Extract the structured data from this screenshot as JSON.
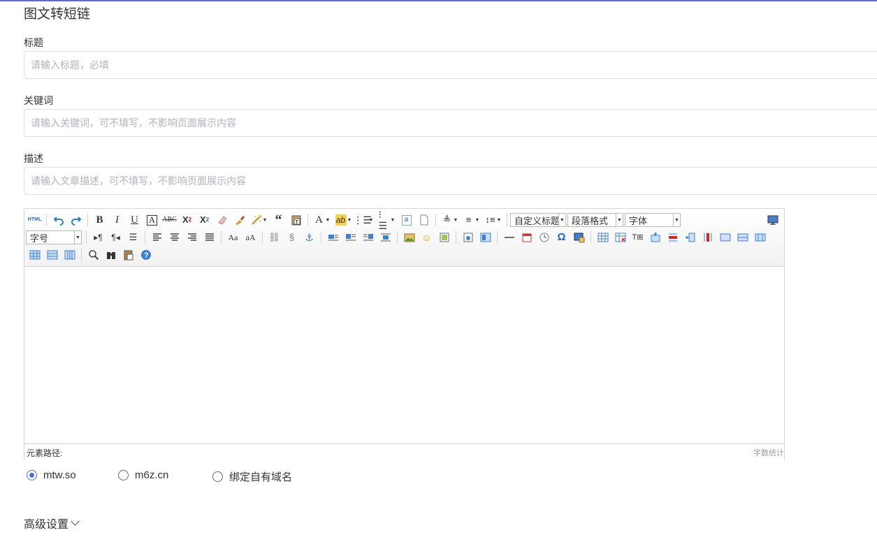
{
  "page_title": "图文转短链",
  "fields": {
    "title": {
      "label": "标题",
      "placeholder": "请输入标题，必填",
      "value": ""
    },
    "keywords": {
      "label": "关键词",
      "placeholder": "请输入关键词，可不填写，不影响页面展示内容",
      "value": ""
    },
    "description": {
      "label": "描述",
      "placeholder": "请输入文章描述，可不填写，不影响页面展示内容",
      "value": ""
    }
  },
  "editor": {
    "combos": {
      "custom_heading": "自定义标题",
      "paragraph": "段落格式",
      "font_family": "字体",
      "font_size": "字号"
    },
    "toolbar_row1": [
      "html-source",
      "undo",
      "redo",
      "bold",
      "italic",
      "underline",
      "font-border",
      "strikethrough",
      "superscript",
      "subscript",
      "remove-format",
      "format-match",
      "auto-typeset",
      "blockquote",
      "paste-plain",
      "font-color",
      "background-color",
      "ordered-list",
      "unordered-list",
      "select-all",
      "clear-doc",
      "row-spacing-top",
      "row-spacing-bottom",
      "line-height",
      "fullscreen"
    ],
    "status_left": "元素路径:",
    "status_right": "字数统计"
  },
  "domains": {
    "options": [
      "mtw.so",
      "m6z.cn",
      "绑定自有域名"
    ],
    "selected": "mtw.so"
  },
  "advanced_label": "高级设置",
  "accent_color": "#4f6bd8"
}
